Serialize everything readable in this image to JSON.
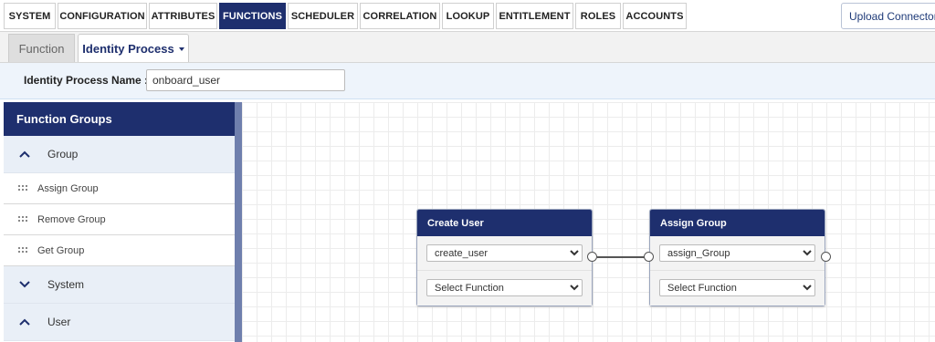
{
  "top_tabs": [
    "SYSTEM",
    "CONFIGURATION",
    "ATTRIBUTES",
    "FUNCTIONS",
    "SCHEDULER",
    "CORRELATION",
    "LOOKUP",
    "ENTITLEMENT",
    "ROLES",
    "ACCOUNTS"
  ],
  "active_top_tab": "FUNCTIONS",
  "upload_button": "Upload Connector",
  "sub_tabs": {
    "function": "Function",
    "identity_process": "Identity Process"
  },
  "identity_process": {
    "label": "Identity Process Name :",
    "value": "onboard_user"
  },
  "function_groups": {
    "title": "Function Groups",
    "group_section": "Group",
    "group_items": [
      "Assign Group",
      "Remove Group",
      "Get Group"
    ],
    "system_section": "System",
    "user_section": "User"
  },
  "nodes": {
    "create_user": {
      "title": "Create User",
      "selected": "create_user",
      "placeholder": "Select Function"
    },
    "assign_group": {
      "title": "Assign Group",
      "selected": "assign_Group",
      "placeholder": "Select Function"
    }
  },
  "colors": {
    "primary": "#1e2f6e",
    "accent": "#6f7fad"
  }
}
